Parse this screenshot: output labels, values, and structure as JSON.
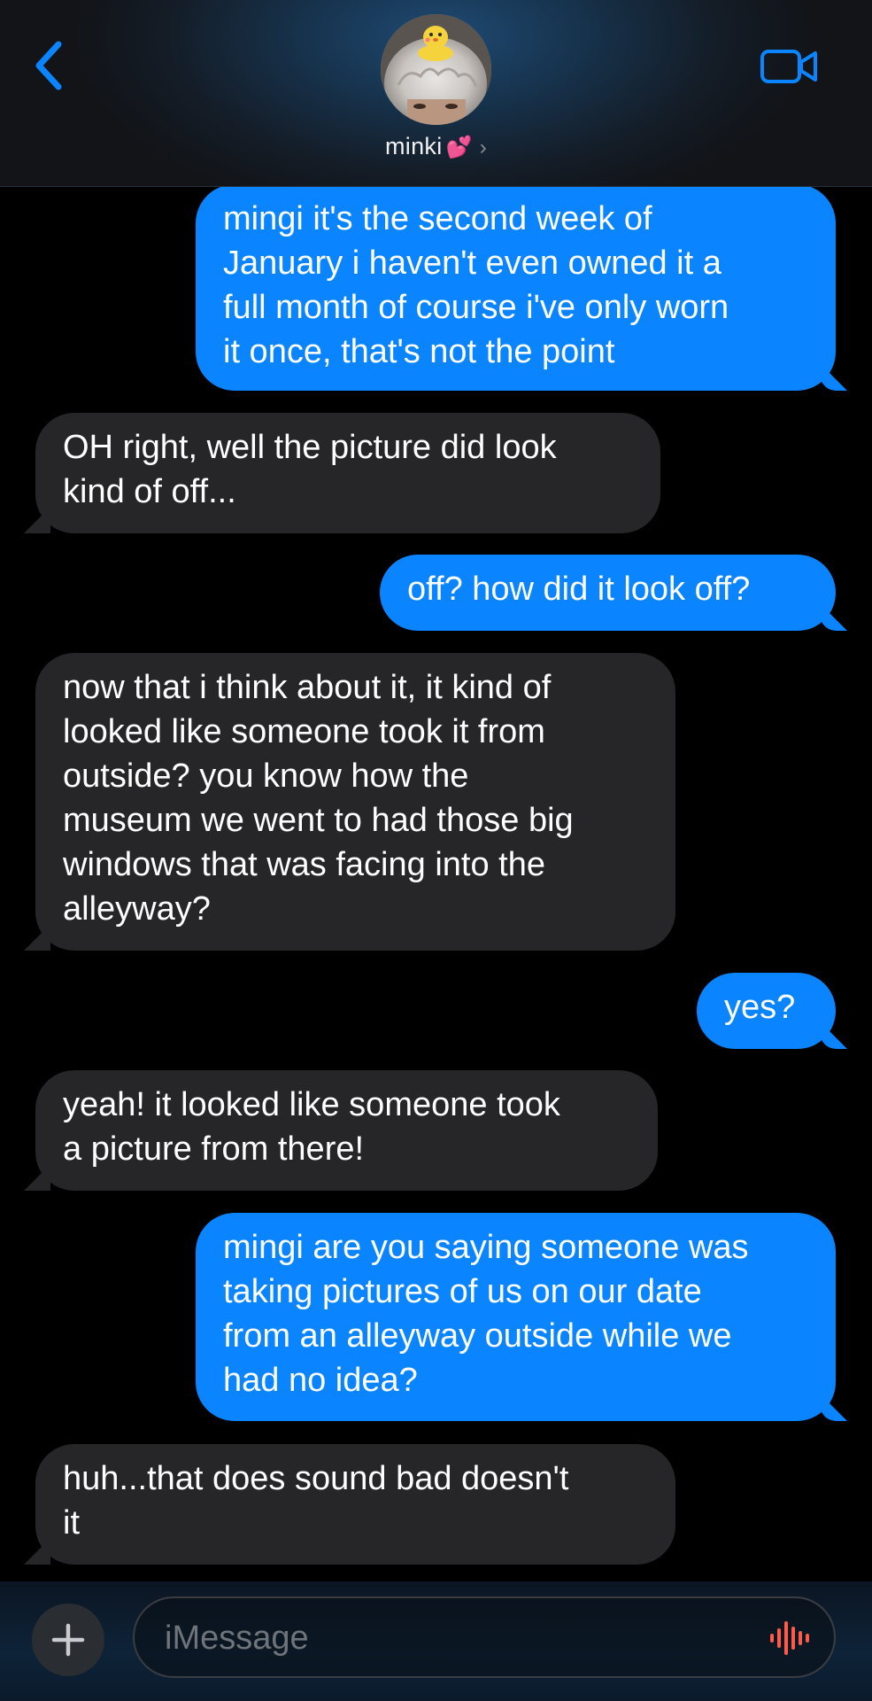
{
  "header": {
    "contact_name": "minki",
    "name_emoji": "💕",
    "chevron": "›",
    "back_icon": "chevron-left-icon",
    "video_icon": "video-camera-icon"
  },
  "messages": [
    {
      "from": "me",
      "text": "mingi it's the second week of\nJanuary i haven't even owned it a\nfull month of course i've only worn\nit once, that's not the point"
    },
    {
      "from": "them",
      "text": "OH right, well the picture did look\nkind of off..."
    },
    {
      "from": "me",
      "text": "off? how did it look off?"
    },
    {
      "from": "them",
      "text": "now that i think about it, it kind of\nlooked like someone took it from\noutside? you know how the\nmuseum we went to had those big\nwindows that was facing into the\nalleyway?"
    },
    {
      "from": "me",
      "text": "yes?"
    },
    {
      "from": "them",
      "text": "yeah! it looked like someone took\na picture from there!"
    },
    {
      "from": "me",
      "text": "mingi are you saying someone was\ntaking pictures of us on our date\nfrom an alleyway outside while we\nhad no idea?"
    },
    {
      "from": "them",
      "text": "huh...that does sound bad doesn't\nit"
    }
  ],
  "composer": {
    "placeholder": "iMessage",
    "plus_icon": "plus-icon",
    "audio_icon": "waveform-icon"
  },
  "colors": {
    "sent_bubble": "#0a84ff",
    "received_bubble": "#262628",
    "accent": "#0a84ff",
    "audio_icon": "#ff5a4a"
  }
}
